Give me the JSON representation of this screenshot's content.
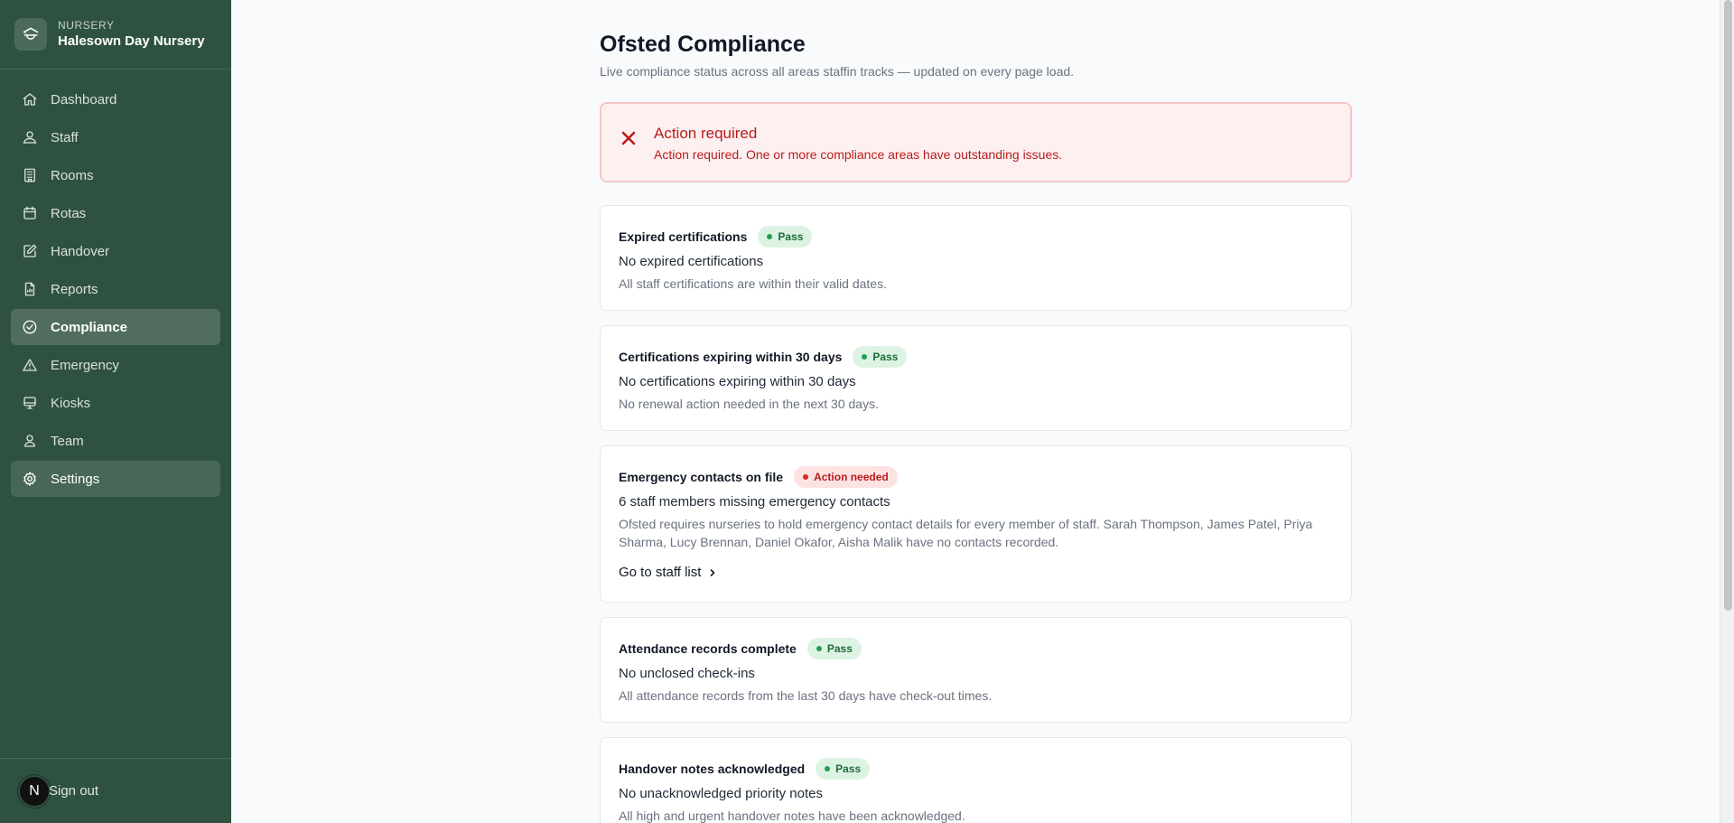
{
  "brand": {
    "kicker": "NURSERY",
    "name": "Halesown Day Nursery"
  },
  "sidebar": {
    "items": [
      {
        "label": "Dashboard",
        "icon": "home-icon"
      },
      {
        "label": "Staff",
        "icon": "user-icon"
      },
      {
        "label": "Rooms",
        "icon": "building-icon"
      },
      {
        "label": "Rotas",
        "icon": "calendar-icon"
      },
      {
        "label": "Handover",
        "icon": "edit-icon"
      },
      {
        "label": "Reports",
        "icon": "document-icon"
      },
      {
        "label": "Compliance",
        "icon": "check-circle-icon",
        "active": true
      },
      {
        "label": "Emergency",
        "icon": "warning-triangle-icon"
      },
      {
        "label": "Kiosks",
        "icon": "monitor-icon"
      },
      {
        "label": "Team",
        "icon": "users-icon"
      },
      {
        "label": "Settings",
        "icon": "gear-icon",
        "hover": true
      }
    ],
    "user_initial": "N",
    "signout_label": "Sign out"
  },
  "page": {
    "title": "Ofsted Compliance",
    "subtitle": "Live compliance status across all areas staffin tracks — updated on every page load."
  },
  "alert": {
    "title": "Action required",
    "text": "Action required. One or more compliance areas have outstanding issues.",
    "color": "#b91c1c"
  },
  "checks": [
    {
      "title": "Expired certifications",
      "status": "Pass",
      "summary": "No expired certifications",
      "detail": "All staff certifications are within their valid dates."
    },
    {
      "title": "Certifications expiring within 30 days",
      "status": "Pass",
      "summary": "No certifications expiring within 30 days",
      "detail": "No renewal action needed in the next 30 days."
    },
    {
      "title": "Emergency contacts on file",
      "status": "Action needed",
      "summary": "6 staff members missing emergency contacts",
      "detail": "Ofsted requires nurseries to hold emergency contact details for every member of staff. Sarah Thompson, James Patel, Priya Sharma, Lucy Brennan, Daniel Okafor, Aisha Malik have no contacts recorded.",
      "link": "Go to staff list"
    },
    {
      "title": "Attendance records complete",
      "status": "Pass",
      "summary": "No unclosed check-ins",
      "detail": "All attendance records from the last 30 days have check-out times."
    },
    {
      "title": "Handover notes acknowledged",
      "status": "Pass",
      "summary": "No unacknowledged priority notes",
      "detail": "All high and urgent handover notes have been acknowledged."
    }
  ],
  "colors": {
    "sidebar": "#2f5240",
    "pass": "#22a053",
    "fail": "#dc2626"
  }
}
